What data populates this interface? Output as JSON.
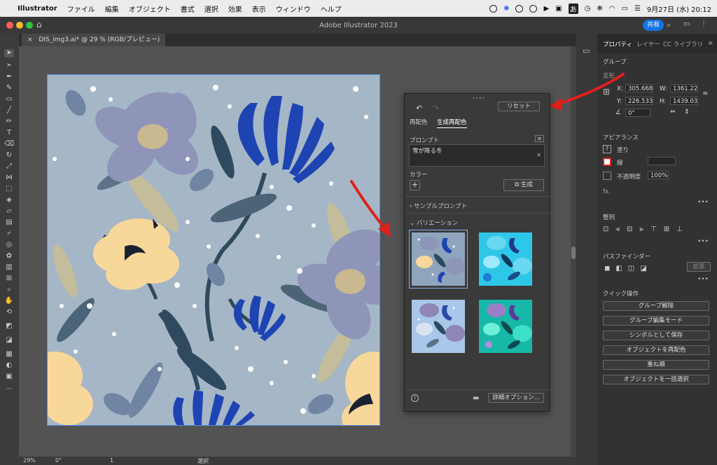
{
  "menubar": {
    "apple": "",
    "app": "Illustrator",
    "items": [
      "ファイル",
      "編集",
      "オブジェクト",
      "書式",
      "選択",
      "効果",
      "表示",
      "ウィンドウ",
      "ヘルプ"
    ],
    "datetime": "9月27日 (水)  20:12",
    "ime": "あ"
  },
  "window": {
    "title": "Adobe Illustrator 2023",
    "share_label": "共有"
  },
  "document": {
    "tab_label": "DIS_img3.ai* @ 29 % (RGB/プレビュー)"
  },
  "status": {
    "zoom": "29%",
    "rotation": "0°",
    "artboard": "1",
    "tool": "選択"
  },
  "recolor": {
    "tab_recolor": "再配色",
    "tab_generative": "生成再配色",
    "reset_label": "リセット",
    "prompt_heading": "プロンプト",
    "prompt_value": "雪が降る冬",
    "color_heading": "カラー",
    "generate_label": "生成",
    "sample_prompts": "サンプルプロンプト",
    "variations_heading": "バリエーション",
    "more_options": "詳細オプション..."
  },
  "properties": {
    "tabs": [
      "プロパティ",
      "レイヤー",
      "CC ライブラリ"
    ],
    "group_label": "グループ",
    "transform_heading": "変形",
    "x_label": "X:",
    "x_value": "305.668",
    "y_label": "Y:",
    "y_value": "226.533",
    "w_label": "W:",
    "w_value": "1361.22",
    "h_label": "H:",
    "h_value": "1439.03",
    "angle_value": "0°",
    "appearance_heading": "アピアランス",
    "fill_label": "塗り",
    "stroke_label": "線",
    "opacity_label": "不透明度",
    "opacity_value": "100%",
    "fx_label": "fx.",
    "align_heading": "整列",
    "pathfinder_heading": "パスファインダー",
    "expand_label": "拡張",
    "quick_heading": "クイック操作",
    "quick_actions": [
      "グループ解除",
      "グループ編集モード",
      "シンボルとして保存",
      "オブジェクトを再配色",
      "重ね順",
      "オブジェクトを一括選択"
    ]
  },
  "colors": {
    "accent": "#1473e6",
    "arrow": "#e0201b",
    "artboard_bg": "#a5b6c6"
  }
}
